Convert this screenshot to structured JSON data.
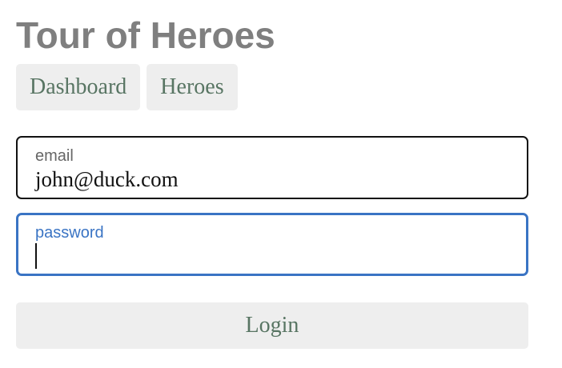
{
  "app": {
    "title": "Tour of Heroes"
  },
  "nav": {
    "items": [
      {
        "label": "Dashboard"
      },
      {
        "label": "Heroes"
      }
    ]
  },
  "login_form": {
    "email": {
      "label": "email",
      "value": "john@duck.com"
    },
    "password": {
      "label": "password",
      "value": "",
      "focused": true
    },
    "submit_label": "Login"
  },
  "colors": {
    "title": "#7f7f7f",
    "nav_text": "#587563",
    "button_bg": "#eeeeee",
    "focus_accent": "#3a74c4"
  }
}
